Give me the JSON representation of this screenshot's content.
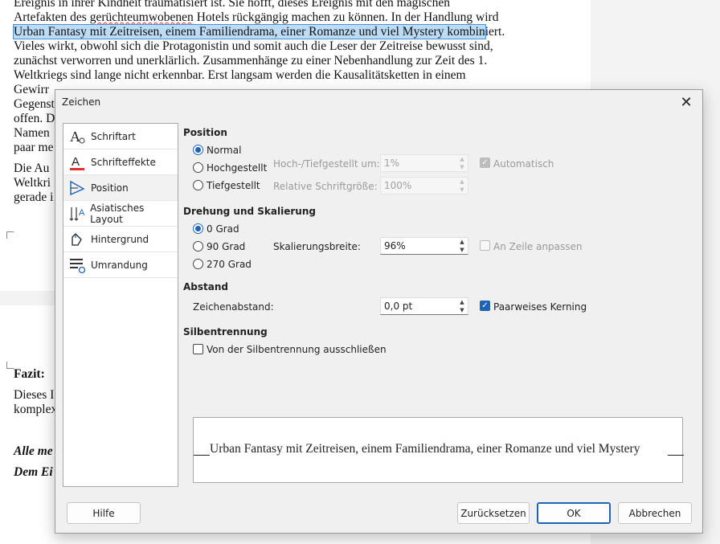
{
  "document": {
    "lines": [
      "Ereignis in ihrer Kindheit traumatisiert ist. Sie hofft, dieses Ereignis mit den magischen",
      "Artefakten des ",
      "gerüchteumwobenen",
      " Hotels rückgängig machen zu können. In der Handlung wird",
      "Urban Fantasy mit Zeitreisen, einem Familiendrama, einer Romanze und viel Mystery kombin",
      "iert.",
      "Vieles wirkt, obwohl sich die Protagonistin und somit auch die Leser der Zeitreise bewusst sind,",
      "zunächst verworren und unerklärlich. Zusammenhänge zu einer Nebenhandlung zur Zeit des 1.",
      "Weltkriegs sind lange nicht erkennbar. Erst langsam werden die Kausalitätsketten in einem",
      "Gewirr",
      "Gegenst",
      "offen. D",
      "Namen",
      "paar me",
      "Die Au",
      "Weltkri",
      "gerade i"
    ],
    "fazit_label": "Fazit:",
    "fazit_lines": [
      "Dieses I",
      "komplex"
    ],
    "italic_lines": [
      "Alle me",
      "Dem Ei"
    ]
  },
  "dialog": {
    "title": "Zeichen",
    "close_glyph": "✕",
    "sidebar": [
      {
        "label": "Schriftart",
        "icon": "font-icon"
      },
      {
        "label": "Schrifteffekte",
        "icon": "font-effects-icon"
      },
      {
        "label": "Position",
        "icon": "position-icon"
      },
      {
        "label": "Asiatisches Layout",
        "icon": "asian-layout-icon"
      },
      {
        "label": "Hintergrund",
        "icon": "highlight-icon"
      },
      {
        "label": "Umrandung",
        "icon": "borders-icon"
      }
    ],
    "position": {
      "heading": "Position",
      "normal": "Normal",
      "superscript": "Hochgestellt",
      "subscript": "Tiefgestellt",
      "raise_label": "Hoch-/Tiefgestellt um:",
      "raise_value": "1%",
      "rel_size_label": "Relative Schriftgröße:",
      "rel_size_value": "100%",
      "automatic": "Automatisch"
    },
    "rotation": {
      "heading": "Drehung und Skalierung",
      "deg0": "0 Grad",
      "deg90": "90 Grad",
      "deg270": "270 Grad",
      "scale_label": "Skalierungsbreite:",
      "scale_value": "96%",
      "fit_line": "An Zeile anpassen"
    },
    "spacing": {
      "heading": "Abstand",
      "char_spacing_label": "Zeichenabstand:",
      "char_spacing_value": "0,0 pt",
      "pair_kerning": "Paarweises Kerning"
    },
    "hyphenation": {
      "heading": "Silbentrennung",
      "exclude": "Von der Silbentrennung ausschließen"
    },
    "preview_text": "Urban Fantasy mit Zeitreisen, einem Familiendrama, einer Romanze und viel Mystery",
    "buttons": {
      "help": "Hilfe",
      "reset": "Zurücksetzen",
      "ok": "OK",
      "cancel": "Abbrechen"
    },
    "colors": {
      "accent": "#1d64b9",
      "selection": "#bcdcf6"
    }
  }
}
